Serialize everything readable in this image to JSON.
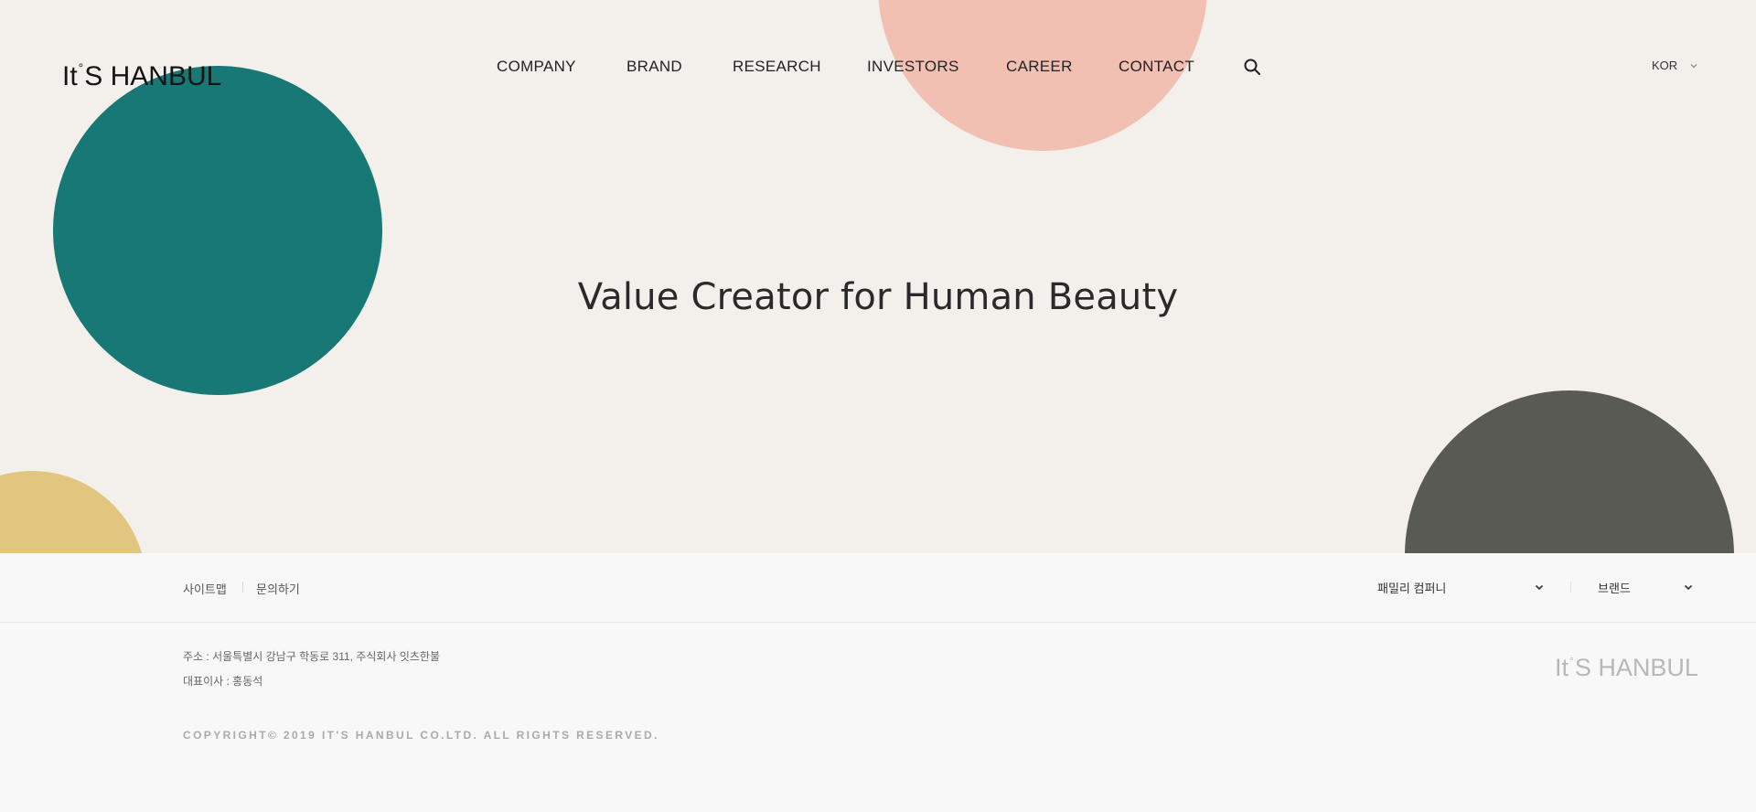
{
  "header": {
    "logo_prefix": "It",
    "logo_degree": "°",
    "logo_suffix": "S HANBUL",
    "nav": [
      "COMPANY",
      "BRAND",
      "RESEARCH",
      "INVESTORS",
      "CAREER",
      "CONTACT"
    ],
    "search_icon": "search-icon",
    "language": "KOR"
  },
  "hero": {
    "headline": "Value Creator for Human Beauty",
    "colors": {
      "background": "#f3f0eb",
      "pink": "#f2c0b3",
      "teal": "#177876",
      "yellow": "#e2c57f",
      "gray": "#5a5a54"
    }
  },
  "footer": {
    "links": [
      "사이트맵",
      "문의하기"
    ],
    "family_select": "패밀리 컴퍼니",
    "brand_select": "브랜드",
    "address": "주소 : 서울특별시 강남구 학동로 311, 주식회사 잇츠한불",
    "ceo": "대표이사 : 홍동석",
    "copyright": "COPYRIGHT© 2019 IT'S HANBUL CO.LTD. ALL RIGHTS RESERVED.",
    "logo_prefix": "It",
    "logo_degree": "°",
    "logo_suffix": "S HANBUL"
  }
}
